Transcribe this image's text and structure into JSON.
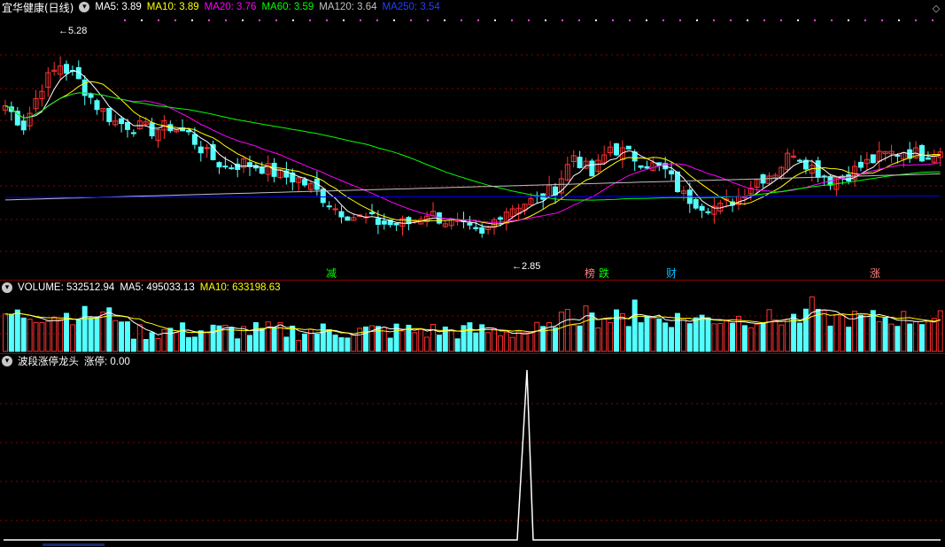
{
  "main_panel": {
    "title": "宜华健康(日线)",
    "legend": [
      {
        "label": "MA5: 3.89",
        "color": "#ffffff"
      },
      {
        "label": "MA10: 3.89",
        "color": "#ffff00"
      },
      {
        "label": "MA20: 3.76",
        "color": "#ff00ff"
      },
      {
        "label": "MA60: 3.59",
        "color": "#00ff00"
      },
      {
        "label": "MA120: 3.64",
        "color": "#c0c0c0"
      },
      {
        "label": "MA250: 3.54",
        "color": "#0000ff"
      }
    ],
    "high_marker": "5.28",
    "low_marker": "2.85",
    "event_tags": [
      {
        "text": "减",
        "color": "#00ff00"
      },
      {
        "text": "榜",
        "color": "#ff8080"
      },
      {
        "text": "跌",
        "color": "#00ff00"
      },
      {
        "text": "财",
        "color": "#00c0ff"
      },
      {
        "text": "涨",
        "color": "#ff8080"
      }
    ]
  },
  "volume_panel": {
    "title": "VOLUME: 532512.94",
    "ma5": "MA5: 495033.13",
    "ma10": "MA10: 633198.63"
  },
  "indicator_panel": {
    "title": "波段涨停龙头",
    "value": "涨停: 0.00"
  },
  "colors": {
    "up": "#ff3232",
    "down": "#54ffff",
    "grid": "#8b0000",
    "ma5": "#ffffff",
    "ma10": "#ffff00",
    "ma20": "#ff00ff",
    "ma60": "#00ff00",
    "ma120": "#c0c0c0",
    "ma250": "#0000ff"
  }
}
